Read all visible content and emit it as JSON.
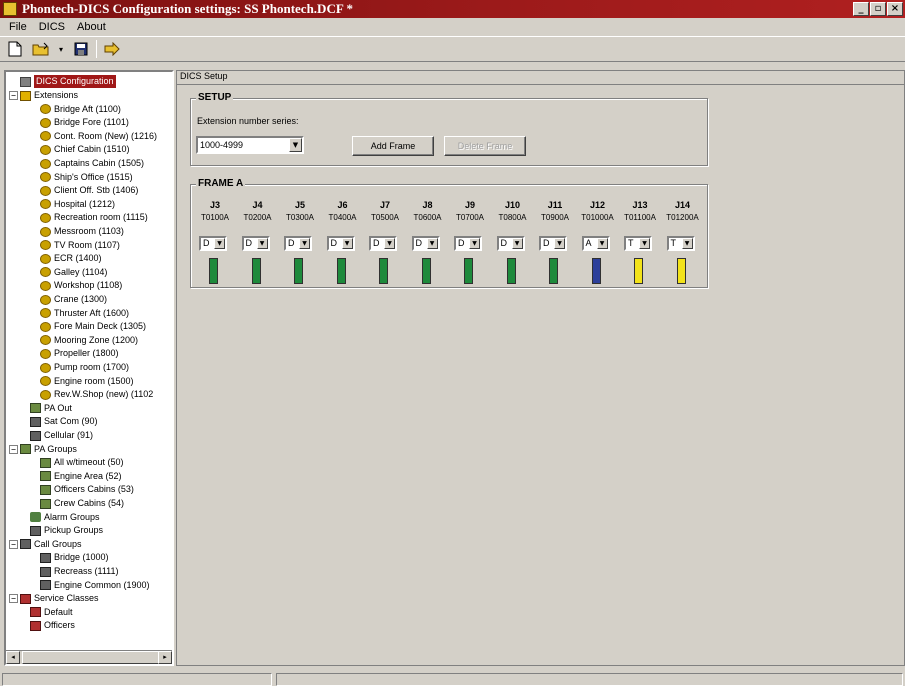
{
  "window": {
    "title": "Phontech-DICS Configuration settings: SS Phontech.DCF *",
    "minimize_glyph": "_",
    "restore_glyph": "▫",
    "close_glyph": "×"
  },
  "menu": {
    "file": "File",
    "dics": "DICS",
    "about": "About"
  },
  "toolbar": {
    "new_icon": "new-document-icon",
    "open_icon": "open-folder-icon",
    "save_icon": "save-disk-icon",
    "run_icon": "run-arrow-icon"
  },
  "tree": {
    "root": "DICS Configuration",
    "items": [
      {
        "label": "Extensions",
        "icon": "folder"
      },
      {
        "label": "Bridge Aft (1100)",
        "icon": "gear"
      },
      {
        "label": "Bridge Fore (1101)",
        "icon": "gear"
      },
      {
        "label": "Cont. Room (New) (1216)",
        "icon": "gear"
      },
      {
        "label": "Chief Cabin (1510)",
        "icon": "gear"
      },
      {
        "label": "Captains Cabin (1505)",
        "icon": "gear"
      },
      {
        "label": "Ship's Office (1515)",
        "icon": "gear"
      },
      {
        "label": "Client Off. Stb (1406)",
        "icon": "gear"
      },
      {
        "label": "Hospital (1212)",
        "icon": "gear"
      },
      {
        "label": "Recreation room (1115)",
        "icon": "gear"
      },
      {
        "label": "Messroom (1103)",
        "icon": "gear"
      },
      {
        "label": "TV Room (1107)",
        "icon": "gear"
      },
      {
        "label": "ECR (1400)",
        "icon": "gear"
      },
      {
        "label": "Galley (1104)",
        "icon": "gear"
      },
      {
        "label": "Workshop (1108)",
        "icon": "gear"
      },
      {
        "label": "Crane (1300)",
        "icon": "gear"
      },
      {
        "label": "Thruster Aft (1600)",
        "icon": "gear"
      },
      {
        "label": "Fore Main Deck (1305)",
        "icon": "gear"
      },
      {
        "label": "Mooring Zone (1200)",
        "icon": "gear"
      },
      {
        "label": "Propeller (1800)",
        "icon": "gear"
      },
      {
        "label": "Pump room (1700)",
        "icon": "gear"
      },
      {
        "label": "Engine room (1500)",
        "icon": "gear"
      },
      {
        "label": "Rev.W.Shop (new) (1102",
        "icon": "gear"
      },
      {
        "label": "PA Out",
        "icon": "group"
      },
      {
        "label": "Sat Com (90)",
        "icon": "phone"
      },
      {
        "label": "Cellular (91)",
        "icon": "phone"
      },
      {
        "label": "PA Groups",
        "icon": "group"
      },
      {
        "label": "All w/timeout (50)",
        "icon": "group"
      },
      {
        "label": "Engine Area (52)",
        "icon": "group"
      },
      {
        "label": "Officers Cabins (53)",
        "icon": "group"
      },
      {
        "label": "Crew Cabins (54)",
        "icon": "group"
      },
      {
        "label": "Alarm Groups",
        "icon": "alarm"
      },
      {
        "label": "Pickup Groups",
        "icon": "phone"
      },
      {
        "label": "Call Groups",
        "icon": "phone"
      },
      {
        "label": "Bridge (1000)",
        "icon": "phone"
      },
      {
        "label": "Recreass (1111)",
        "icon": "phone"
      },
      {
        "label": "Engine Common (1900)",
        "icon": "phone"
      },
      {
        "label": "Service Classes",
        "icon": "svc"
      },
      {
        "label": "Default",
        "icon": "svc"
      },
      {
        "label": "Officers",
        "icon": "svc"
      }
    ]
  },
  "panel": {
    "tab": "DICS Setup",
    "setup": {
      "title": "SETUP",
      "series_label": "Extension number series:",
      "series_value": "1000-4999",
      "add_frame": "Add Frame",
      "delete_frame": "Delete Frame"
    },
    "frame": {
      "title": "FRAME A",
      "columns": [
        {
          "j": "J3",
          "t": "T0100A",
          "mode": "D",
          "color": "#1e8a3c"
        },
        {
          "j": "J4",
          "t": "T0200A",
          "mode": "D",
          "color": "#1e8a3c"
        },
        {
          "j": "J5",
          "t": "T0300A",
          "mode": "D",
          "color": "#1e8a3c"
        },
        {
          "j": "J6",
          "t": "T0400A",
          "mode": "D",
          "color": "#1e8a3c"
        },
        {
          "j": "J7",
          "t": "T0500A",
          "mode": "D",
          "color": "#1e8a3c"
        },
        {
          "j": "J8",
          "t": "T0600A",
          "mode": "D",
          "color": "#1e8a3c"
        },
        {
          "j": "J9",
          "t": "T0700A",
          "mode": "D",
          "color": "#1e8a3c"
        },
        {
          "j": "J10",
          "t": "T0800A",
          "mode": "D",
          "color": "#1e8a3c"
        },
        {
          "j": "J11",
          "t": "T0900A",
          "mode": "D",
          "color": "#1e8a3c"
        },
        {
          "j": "J12",
          "t": "T01000A",
          "mode": "A",
          "color": "#2c3f9a"
        },
        {
          "j": "J13",
          "t": "T01100A",
          "mode": "T",
          "color": "#f2e21a"
        },
        {
          "j": "J14",
          "t": "T01200A",
          "mode": "T",
          "color": "#f2e21a"
        }
      ]
    }
  }
}
